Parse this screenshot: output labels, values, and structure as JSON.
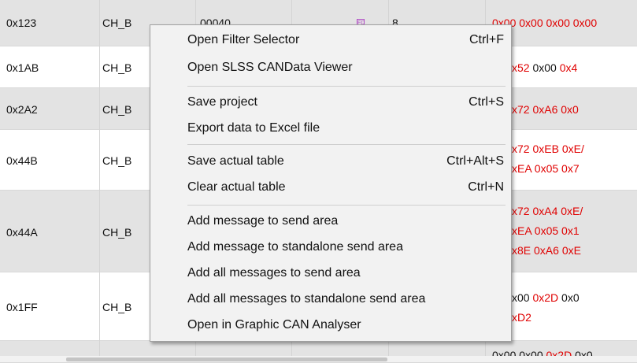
{
  "rows": [
    {
      "id": "0x123",
      "ch": "CH_B",
      "extra": "00040",
      "dlc": "8",
      "data": [
        {
          "t": "0x00 0x00 0x00 0x00",
          "c": "red"
        }
      ]
    },
    {
      "id": "0x1AB",
      "ch": "CH_B",
      "data": [
        {
          "t": "x52",
          "c": "red"
        },
        {
          "t": " 0x00 ",
          "c": "blk"
        },
        {
          "t": "0x4",
          "c": "red"
        }
      ]
    },
    {
      "id": "0x2A2",
      "ch": "CH_B",
      "data": [
        {
          "t": "x72 0xA6 0x0",
          "c": "red"
        }
      ]
    },
    {
      "id": "0x44B",
      "ch": "CH_B",
      "data": [
        {
          "t": "x72 0xEB 0xE/",
          "c": "red"
        }
      ],
      "data2": [
        {
          "t": "xEA 0x05 0x7",
          "c": "red"
        }
      ]
    },
    {
      "id": "0x44A",
      "ch": "CH_B",
      "data": [
        {
          "t": "x72 0xA4 0xE/",
          "c": "red"
        }
      ],
      "data2": [
        {
          "t": "xEA 0x05 0x1",
          "c": "red"
        }
      ],
      "data3": [
        {
          "t": "x8E 0xA6 0xE",
          "c": "red"
        }
      ]
    },
    {
      "id": "0x1FF",
      "ch": "CH_B",
      "data": [
        {
          "t": "x00 ",
          "c": "blk"
        },
        {
          "t": "0x2D",
          "c": "red"
        },
        {
          "t": " 0x0",
          "c": "blk"
        }
      ],
      "data2": [
        {
          "t": "xD2",
          "c": "red"
        }
      ]
    },
    {
      "id": "",
      "ch": "",
      "data": [
        {
          "t": "0x00 0x00 ",
          "c": "blk"
        },
        {
          "t": "0x2D",
          "c": "red"
        },
        {
          "t": " 0x0",
          "c": "blk"
        }
      ]
    }
  ],
  "fd_badge": "FD",
  "menu": {
    "items": [
      {
        "label": "Open Filter Selector",
        "shortcut": "Ctrl+F"
      },
      {
        "label": "Open SLSS CANData Viewer",
        "shortcut": ""
      },
      {
        "label": "Save project",
        "shortcut": "Ctrl+S"
      },
      {
        "label": "Export data to Excel file",
        "shortcut": ""
      },
      {
        "label": "Save actual table",
        "shortcut": "Ctrl+Alt+S"
      },
      {
        "label": "Clear actual table",
        "shortcut": "Ctrl+N"
      },
      {
        "label": "Add message to send area",
        "shortcut": ""
      },
      {
        "label": "Add message to standalone send area",
        "shortcut": ""
      },
      {
        "label": "Add all messages to send area",
        "shortcut": ""
      },
      {
        "label": "Add all messages to standalone send area",
        "shortcut": ""
      },
      {
        "label": "Open in Graphic CAN Analyser",
        "shortcut": ""
      }
    ]
  }
}
